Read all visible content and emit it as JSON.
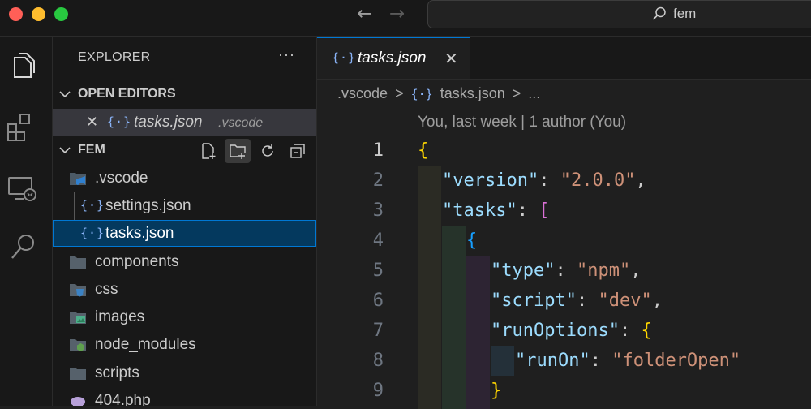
{
  "titlebar": {
    "search_text": "fem",
    "back_icon": "arrow-left-icon",
    "forward_icon": "arrow-right-icon"
  },
  "activitybar": {
    "items": [
      "files-icon",
      "extensions-icon",
      "remote-explorer-icon",
      "search-icon"
    ]
  },
  "sidebar": {
    "title": "EXPLORER",
    "more": "···",
    "open_editors": {
      "label": "OPEN EDITORS",
      "item": {
        "close": "✕",
        "glyph": "{·}",
        "name": "tasks.json",
        "path": ".vscode"
      }
    },
    "folder": {
      "label": "FEM",
      "tree": [
        {
          "name": ".vscode",
          "icon": "vscode-folder-icon"
        },
        {
          "name": "settings.json",
          "icon": "json-icon"
        },
        {
          "name": "tasks.json",
          "icon": "json-icon"
        },
        {
          "name": "components",
          "icon": "folder-icon"
        },
        {
          "name": "css",
          "icon": "css-folder-icon"
        },
        {
          "name": "images",
          "icon": "images-folder-icon"
        },
        {
          "name": "node_modules",
          "icon": "node-folder-icon"
        },
        {
          "name": "scripts",
          "icon": "folder-icon"
        },
        {
          "name": "404.php",
          "icon": "php-icon"
        }
      ]
    }
  },
  "editor": {
    "tab": {
      "glyph": "{·}",
      "label": "tasks.json",
      "close": "✕"
    },
    "breadcrumb": [
      ".vscode",
      ">",
      "{·}",
      "tasks.json",
      ">",
      "..."
    ],
    "blame": "You, last week | 1 author (You)",
    "line_numbers": [
      "1",
      "2",
      "3",
      "4",
      "5",
      "6",
      "7",
      "8",
      "9"
    ],
    "code": [
      "{",
      "\"version\": \"2.0.0\",",
      "\"tasks\": [",
      "{",
      "\"type\": \"npm\",",
      "\"script\": \"dev\",",
      "\"runOptions\": {",
      "\"runOn\": \"folderOpen\"",
      "}"
    ]
  },
  "colors": {
    "accent": "#0078d4",
    "selection": "#04395e",
    "string": "#ce9178",
    "key": "#9cdcfe",
    "bracket_gold": "#ffd700",
    "bracket_purple": "#da70d6",
    "bracket_blue": "#179fff"
  }
}
